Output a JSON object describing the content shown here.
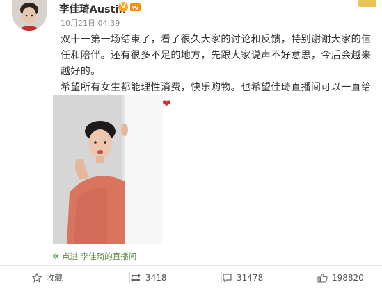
{
  "header": {
    "username": "李佳琦Austin",
    "verified_badge": "V",
    "timestamp": "10月21日 04:39"
  },
  "post": {
    "paragraphs": [
      "双十一第一场结束了，看了很久大家的讨论和反馈，特别谢谢大家的信任和陪伴。还有很多不足的地方，先跟大家说声不好意思，今后会越来越好的。",
      "希望所有女生都能理性消费，快乐购物。也希望佳琦直播间可以一直给大家带来欢乐和陪伴。"
    ],
    "emoji": "❤",
    "live_link": {
      "prefix": "点进",
      "name": "李佳琦的直播间"
    }
  },
  "actions": {
    "favorite_label": "收藏",
    "repost_count": "3418",
    "comment_count": "31478",
    "like_count": "198820"
  },
  "colors": {
    "link_green": "#5a8c3f",
    "heart_red": "#e02b2b",
    "badge_orange": "#f6a623"
  }
}
